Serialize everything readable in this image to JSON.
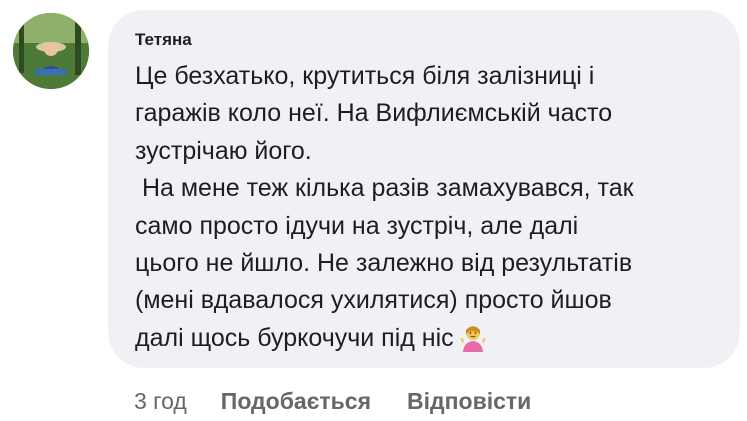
{
  "comment": {
    "author": "Тетяна",
    "avatar_icon": "profile-photo",
    "lines": [
      "Це безхатько, крутиться біля залізниці і",
      "гаражів коло неї. На Вифлиємській часто",
      "зустрічаю його.",
      " На мене теж кілька разів замахувався, так",
      "само просто ідучи на зустріч, але далі",
      "цього не йшло. Не залежно від результатів",
      "(мені вдавалося ухилятися) просто йшов",
      "далі щось буркочучи під ніс"
    ],
    "emoji": "person-shrugging-emoji"
  },
  "actions": {
    "timestamp": "3 год",
    "like_label": "Подобається",
    "reply_label": "Відповісти"
  },
  "colors": {
    "bubble_bg": "#eff1f4",
    "text": "#1c1e21",
    "secondary_text": "#65676b"
  }
}
